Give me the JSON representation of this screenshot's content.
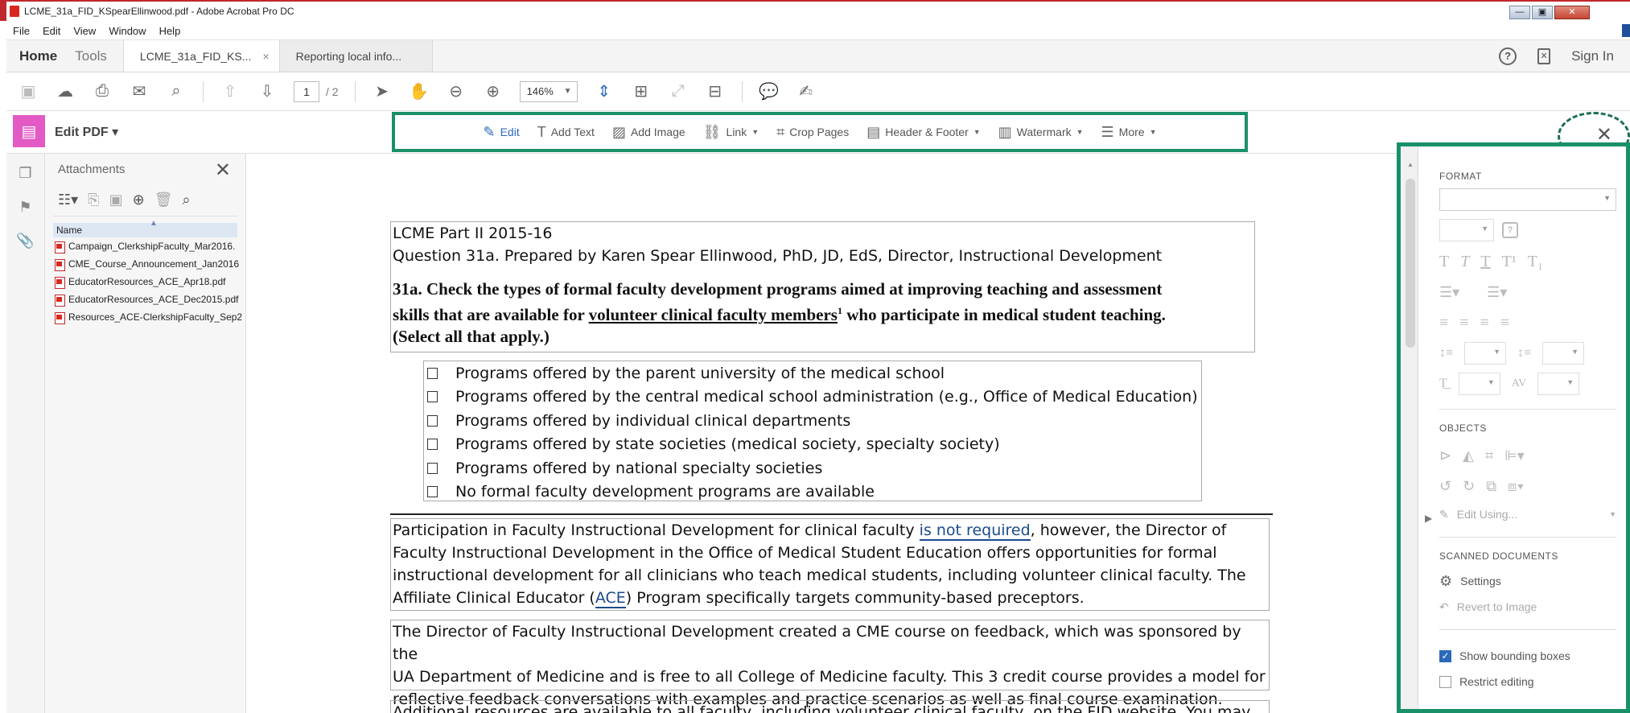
{
  "window": {
    "title": "LCME_31a_FID_KSpearEllinwood.pdf - Adobe Acrobat Pro DC",
    "controls": [
      "—",
      "▣",
      "✕"
    ]
  },
  "menu": [
    "File",
    "Edit",
    "View",
    "Window",
    "Help"
  ],
  "tabs": {
    "home": "Home",
    "tools": "Tools",
    "doc_tabs": [
      {
        "label": "LCME_31a_FID_KS...",
        "close": "×"
      },
      {
        "label": "Reporting local info..."
      }
    ],
    "help": "?",
    "sign_in": "Sign In"
  },
  "toolbar": {
    "page_current": "1",
    "page_total": "/ 2",
    "zoom": "146%"
  },
  "editbar": {
    "title": "Edit PDF ▾",
    "tools": [
      {
        "label": "Edit",
        "icon": "edit-icon",
        "glyph": "✎",
        "dropdown": false
      },
      {
        "label": "Add Text",
        "icon": "add-text-icon",
        "glyph": "T",
        "dropdown": false
      },
      {
        "label": "Add Image",
        "icon": "add-image-icon",
        "glyph": "▨",
        "dropdown": false
      },
      {
        "label": "Link",
        "icon": "link-icon",
        "glyph": "⛓",
        "dropdown": true
      },
      {
        "label": "Crop Pages",
        "icon": "crop-icon",
        "glyph": "⌗",
        "dropdown": false
      },
      {
        "label": "Header & Footer",
        "icon": "header-footer-icon",
        "glyph": "▤",
        "dropdown": true
      },
      {
        "label": "Watermark",
        "icon": "watermark-icon",
        "glyph": "▥",
        "dropdown": true
      },
      {
        "label": "More",
        "icon": "more-icon",
        "glyph": "☰",
        "dropdown": true
      }
    ],
    "close": "✕"
  },
  "attachments": {
    "title": "Attachments",
    "column": "Name",
    "files": [
      "Campaign_ClerkshipFaculty_Mar2016.",
      "CME_Course_Announcement_Jan2016",
      "EducatorResources_ACE_Apr18.pdf",
      "EducatorResources_ACE_Dec2015.pdf",
      "Resources_ACE-ClerkshipFaculty_Sep2"
    ]
  },
  "document": {
    "header_line1": "LCME Part II 2015-16",
    "header_line2": "Question 31a. Prepared by Karen Spear Ellinwood, PhD, JD, EdS, Director, Instructional Development",
    "q_line1": "31a. Check the types of formal faculty development programs aimed at improving teaching and assessment",
    "q_line2_pre": "skills that are available for ",
    "q_line2_u": "volunteer clinical faculty members",
    "q_line2_sup": "1",
    "q_line2_post": " who participate in medical student teaching.",
    "q_line3": "(Select all that apply.)",
    "options": [
      "Programs offered by the parent university of the medical school",
      "Programs offered by the central medical school administration (e.g., Office of Medical Education)",
      "Programs offered by individual clinical departments",
      "Programs offered by state societies (medical society, specialty society)",
      "Programs offered by national specialty societies",
      "No formal faculty development programs are available"
    ],
    "p1_l1_pre": "Participation in Faculty Instructional Development for clinical faculty ",
    "p1_l1_link": "is not required",
    "p1_l1_post": ", however, the Director of",
    "p1_l2": "Faculty Instructional Development in the Office of Medical Student Education offers opportunities for formal",
    "p1_l3": "instructional development for all clinicians who teach medical students, including volunteer clinical faculty.  The",
    "p1_l4_pre": "Affiliate Clinical Educator (",
    "p1_l4_link": "ACE",
    "p1_l4_post": ") Program specifically targets community-based preceptors.",
    "p2_l1": "The Director of Faculty Instructional Development created a CME course on feedback, which was sponsored by the",
    "p2_l2": "UA Department of Medicine and is free to all College of Medicine faculty. This 3 credit course provides a model for",
    "p2_l3": "reflective feedback conversations with examples and practice scenarios as well as final course examination.",
    "p3_l1": "Additional resources are available to all faculty, including volunteer clinical faculty, on the FID website. You may"
  },
  "format_panel": {
    "format_heading": "FORMAT",
    "objects_heading": "OBJECTS",
    "edit_using": "Edit Using...",
    "scanned_heading": "SCANNED DOCUMENTS",
    "settings": "Settings",
    "revert": "Revert to Image",
    "show_bounding": "Show bounding boxes",
    "restrict": "Restrict editing",
    "show_bounding_checked": true,
    "restrict_checked": false
  },
  "colors": {
    "highlight_green": "#199069",
    "link_blue": "#1a4a8c",
    "edit_pink": "#e35ac5"
  }
}
